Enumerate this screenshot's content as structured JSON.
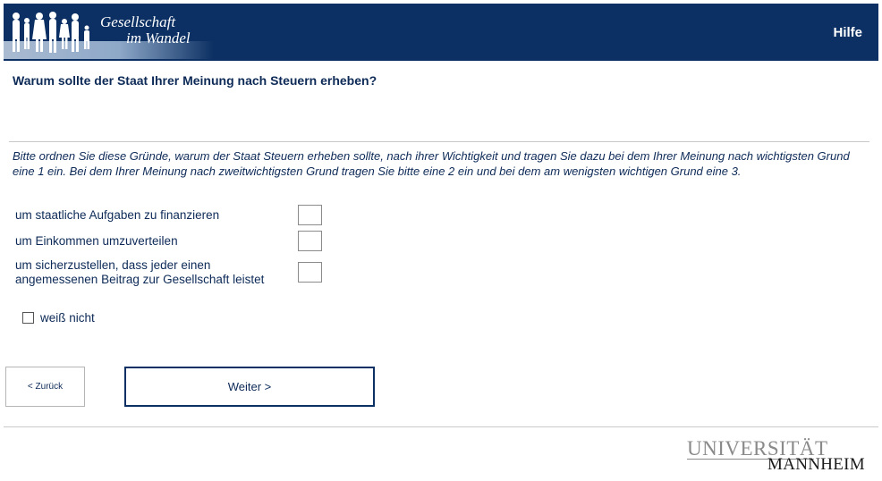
{
  "header": {
    "logo_line1": "Gesellschaft",
    "logo_line2": "im Wandel",
    "help_label": "Hilfe"
  },
  "question": "Warum sollte der Staat Ihrer Meinung nach Steuern erheben?",
  "instruction": "Bitte ordnen Sie diese Gründe, warum der Staat Steuern erheben sollte, nach ihrer Wichtigkeit und tragen Sie dazu bei dem Ihrer Meinung nach wichtigsten Grund eine 1 ein. Bei dem Ihrer Meinung nach zweitwichtigsten Grund tragen Sie bitte eine 2 ein und bei dem am wenigsten wichtigen Grund eine 3.",
  "items": [
    {
      "label": "um staatliche Aufgaben zu finanzieren",
      "value": ""
    },
    {
      "label": "um Einkommen umzuverteilen",
      "value": ""
    },
    {
      "label_line1": "um sicherzustellen, dass jeder einen",
      "label_line2": "angemessenen Beitrag zur Gesellschaft leistet",
      "value": ""
    }
  ],
  "dont_know_label": "weiß nicht",
  "nav": {
    "back_label": "< Zurück",
    "next_label": "Weiter >"
  },
  "footer": {
    "uni_line1": "UNIVERSITÄT",
    "uni_line2": "MANNHEIM"
  },
  "colors": {
    "header_bg": "#0c3063",
    "text": "#0d2a57",
    "logo_gray": "#8a8a8a"
  }
}
